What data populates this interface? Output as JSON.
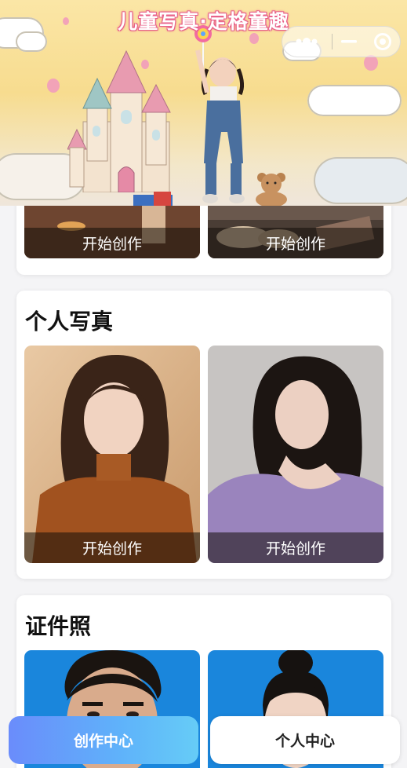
{
  "banner": {
    "title": "儿童写真·定格童趣"
  },
  "capsule": {
    "more_icon": "more-dots-icon",
    "minimize_icon": "minimize-icon",
    "close_icon": "target-circle-icon"
  },
  "sections": [
    {
      "title": "",
      "tiles": [
        {
          "label": "开始创作"
        },
        {
          "label": "开始创作"
        }
      ]
    },
    {
      "title": "个人写真",
      "tiles": [
        {
          "label": "开始创作"
        },
        {
          "label": "开始创作"
        }
      ]
    },
    {
      "title": "证件照",
      "tiles": [
        {
          "label": ""
        },
        {
          "label": ""
        }
      ]
    }
  ],
  "nav": {
    "create_center": "创作中心",
    "personal_center": "个人中心"
  },
  "colors": {
    "nav_gradient_start": "#6a8cfb",
    "nav_gradient_end": "#66ccf7",
    "id_photo_bg": "#1a86dc"
  }
}
